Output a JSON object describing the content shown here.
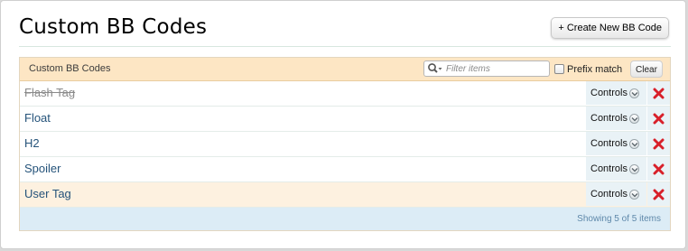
{
  "page": {
    "title": "Custom BB Codes",
    "create_button_label": "+ Create New BB Code"
  },
  "list": {
    "heading": "Custom BB Codes",
    "filter": {
      "placeholder": "Filter items",
      "value": "",
      "icon": "search-icon"
    },
    "prefix_match": {
      "label": "Prefix match",
      "checked": false
    },
    "clear_label": "Clear",
    "rows": [
      {
        "title": "Flash Tag",
        "disabled": true,
        "controls_label": "Controls"
      },
      {
        "title": "Float",
        "disabled": false,
        "controls_label": "Controls"
      },
      {
        "title": "H2",
        "disabled": false,
        "controls_label": "Controls"
      },
      {
        "title": "Spoiler",
        "disabled": false,
        "controls_label": "Controls"
      },
      {
        "title": "User Tag",
        "disabled": false,
        "controls_label": "Controls",
        "highlighted": true
      }
    ],
    "footer_text": "Showing 5 of 5 items"
  },
  "colors": {
    "header_bg": "#fde6c4",
    "link": "#25537a",
    "footer_bg": "#dcecf6",
    "delete": "#d8202a",
    "highlight_row": "#fdf1e0"
  }
}
